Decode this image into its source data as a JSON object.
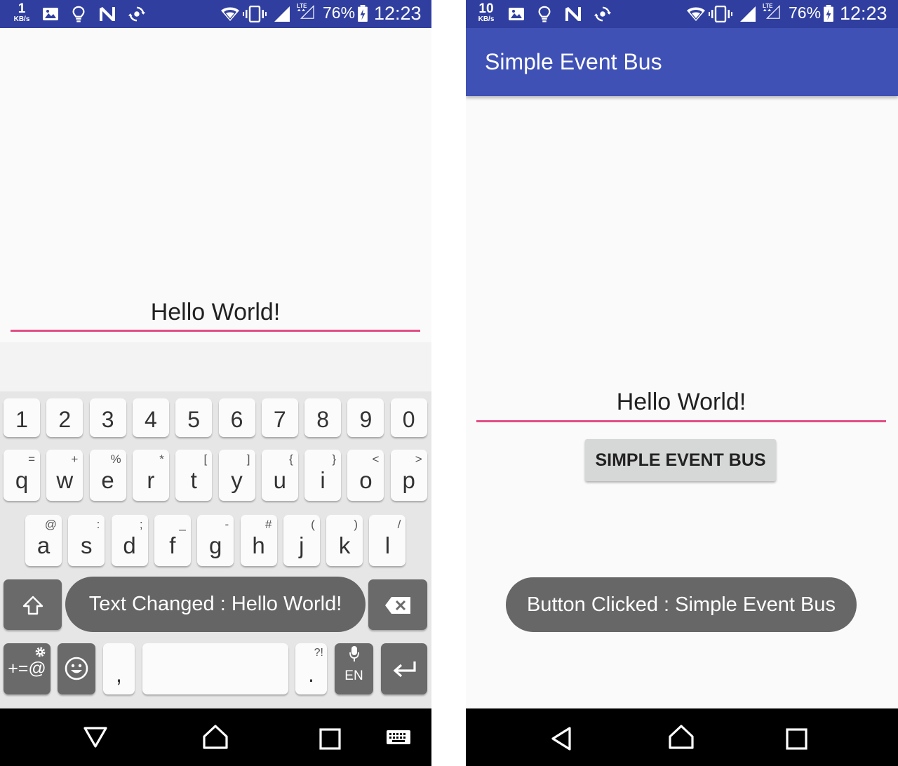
{
  "left_screen": {
    "status_bar": {
      "net_speed_value": "1",
      "net_speed_unit": "KB/s",
      "battery": "76%",
      "time": "12:23"
    },
    "edit_text": {
      "value": "Hello World!"
    },
    "keyboard": {
      "number_row": [
        "1",
        "2",
        "3",
        "4",
        "5",
        "6",
        "7",
        "8",
        "9",
        "0"
      ],
      "row1": [
        {
          "key": "q",
          "hint": "="
        },
        {
          "key": "w",
          "hint": "+"
        },
        {
          "key": "e",
          "hint": "%"
        },
        {
          "key": "r",
          "hint": "*"
        },
        {
          "key": "t",
          "hint": "["
        },
        {
          "key": "y",
          "hint": "]"
        },
        {
          "key": "u",
          "hint": "{"
        },
        {
          "key": "i",
          "hint": "}"
        },
        {
          "key": "o",
          "hint": "<"
        },
        {
          "key": "p",
          "hint": ">"
        }
      ],
      "row2": [
        {
          "key": "a",
          "hint": "@"
        },
        {
          "key": "s",
          "hint": ":"
        },
        {
          "key": "d",
          "hint": ";"
        },
        {
          "key": "f",
          "hint": "_"
        },
        {
          "key": "g",
          "hint": "-"
        },
        {
          "key": "h",
          "hint": "#"
        },
        {
          "key": "j",
          "hint": "("
        },
        {
          "key": "k",
          "hint": ")"
        },
        {
          "key": "l",
          "hint": "/"
        }
      ],
      "symbols_key": "+=@",
      "comma_key": ",",
      "period_key": ".",
      "period_hint": "?!",
      "language_key": "EN"
    },
    "toast": "Text Changed : Hello World!"
  },
  "right_screen": {
    "status_bar": {
      "net_speed_value": "10",
      "net_speed_unit": "KB/s",
      "battery": "76%",
      "time": "12:23"
    },
    "toolbar": {
      "title": "Simple Event Bus"
    },
    "edit_text": {
      "value": "Hello World!"
    },
    "button": {
      "label": "SIMPLE EVENT BUS"
    },
    "toast": "Button Clicked : Simple Event Bus"
  },
  "colors": {
    "status_bar": "#303F9F",
    "toolbar": "#3F51B5",
    "accent_underline": "#E14D85",
    "toast": "#5A5A5A",
    "nav_bar": "#000000",
    "button": "#D6D7D7"
  }
}
